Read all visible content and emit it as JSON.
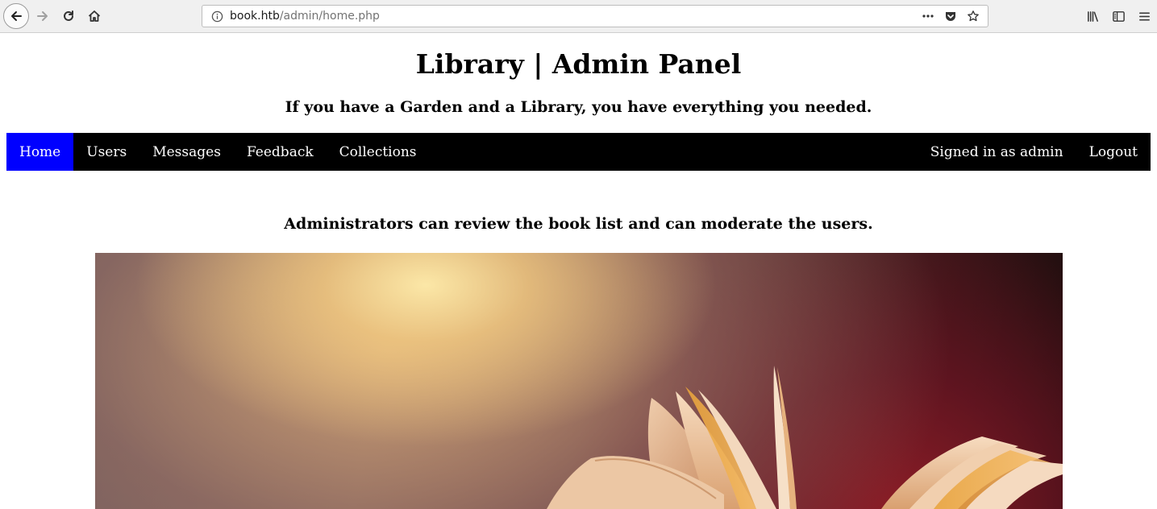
{
  "browser": {
    "url_host": "book.htb",
    "url_path": "/admin/home.php",
    "icons": {
      "back": "back-arrow-icon",
      "forward": "forward-arrow-icon",
      "reload": "reload-icon",
      "home": "home-icon",
      "info": "site-info-icon",
      "more": "more-dots-icon",
      "pocket": "pocket-icon",
      "bookmark": "star-icon",
      "library": "library-icon",
      "sidebar": "sidebar-icon",
      "menu": "hamburger-menu-icon"
    }
  },
  "header": {
    "title": "Library | Admin Panel",
    "subtitle": "If you have a Garden and a Library, you have everything you needed."
  },
  "nav": {
    "items": [
      {
        "label": "Home",
        "active": true
      },
      {
        "label": "Users",
        "active": false
      },
      {
        "label": "Messages",
        "active": false
      },
      {
        "label": "Feedback",
        "active": false
      },
      {
        "label": "Collections",
        "active": false
      }
    ],
    "signed_in": "Signed in as admin",
    "logout": "Logout",
    "colors": {
      "bar": "#000000",
      "active": "#0000ff",
      "text": "#ffffff"
    }
  },
  "main": {
    "intro": "Administrators can review the book list and can moderate the users."
  }
}
